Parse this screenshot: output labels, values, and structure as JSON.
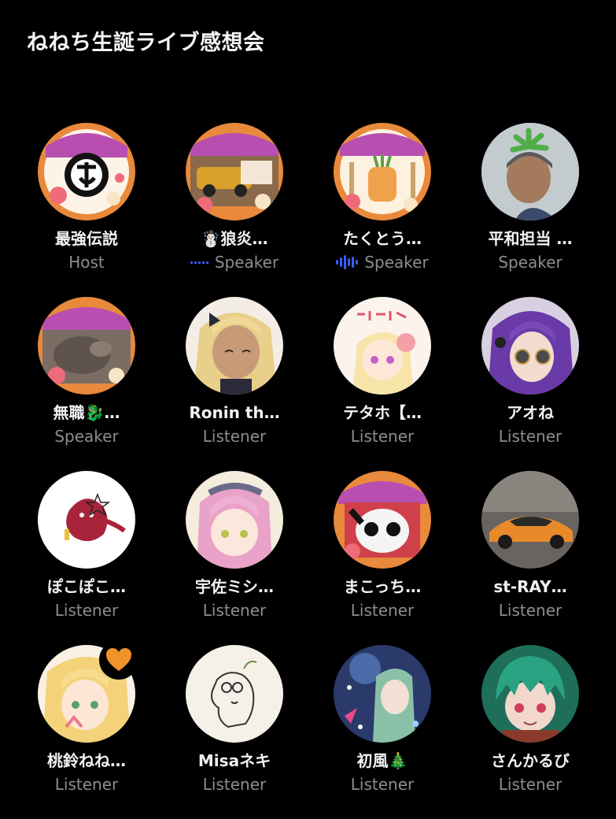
{
  "room": {
    "title": "ねねち生誕ライブ感想会"
  },
  "participants": [
    {
      "name": "最強伝説",
      "role": "Host",
      "avatar": "nene-banner-ne-logo-avatar",
      "speaking": "none"
    },
    {
      "name": "☃️狼炎…",
      "role": "Speaker",
      "avatar": "nene-banner-car-avatar",
      "speaking": "dots"
    },
    {
      "name": "たくとう…",
      "role": "Speaker",
      "avatar": "nene-banner-carrot-avatar",
      "speaking": "bars"
    },
    {
      "name": "平和担当 …",
      "role": "Speaker",
      "avatar": "photo-person-with-plant-avatar",
      "speaking": "none"
    },
    {
      "name": "無職🐉…",
      "role": "Speaker",
      "avatar": "nene-banner-cat-avatar",
      "speaking": "none"
    },
    {
      "name": "Ronin th…",
      "role": "Listener",
      "avatar": "anime-blonde-girl-avatar",
      "speaking": "none"
    },
    {
      "name": "テタホ【…",
      "role": "Listener",
      "avatar": "anime-tetaho-sketch-avatar",
      "speaking": "none"
    },
    {
      "name": "アオね",
      "role": "Listener",
      "avatar": "anime-purple-hair-sunglasses-avatar",
      "speaking": "none"
    },
    {
      "name": "ぽこぽこ…",
      "role": "Listener",
      "avatar": "red-creature-illustration-avatar",
      "speaking": "none"
    },
    {
      "name": "宇佐ミシ…",
      "role": "Listener",
      "avatar": "anime-pink-hair-girl-avatar",
      "speaking": "none"
    },
    {
      "name": "まこっち…",
      "role": "Listener",
      "avatar": "nene-banner-panda-avatar",
      "speaking": "none"
    },
    {
      "name": "st-RAY…",
      "role": "Listener",
      "avatar": "orange-sports-car-avatar",
      "speaking": "none"
    },
    {
      "name": "桃鈴ねね…",
      "role": "Listener",
      "avatar": "anime-blonde-nene-avatar",
      "speaking": "none",
      "badge": "heart-icon"
    },
    {
      "name": "Misaネキ",
      "role": "Listener",
      "avatar": "line-drawing-character-avatar",
      "speaking": "none"
    },
    {
      "name": "初風🎄",
      "role": "Listener",
      "avatar": "anime-green-hair-sparkle-avatar",
      "speaking": "none"
    },
    {
      "name": "さんかるび",
      "role": "Listener",
      "avatar": "anime-green-hair-boy-avatar",
      "speaking": "none"
    }
  ],
  "colors": {
    "background": "#000000",
    "speaking_indicator": "#3b5bff",
    "role_text": "#8d8d8d",
    "heart": "#f0932b",
    "banner_orange": "#e58a3a"
  }
}
